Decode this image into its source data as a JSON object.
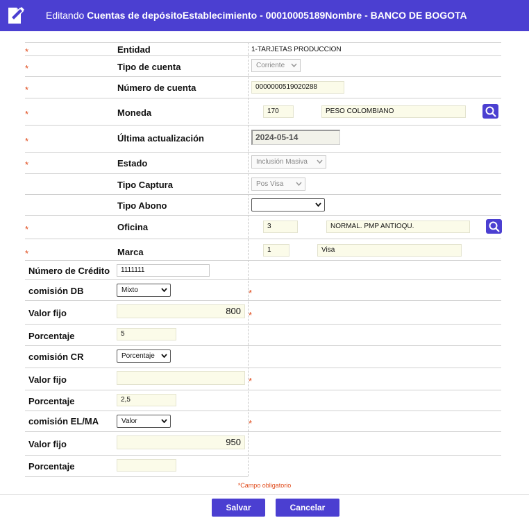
{
  "header": {
    "prefix": "Editando",
    "title": "Cuentas de depósitoEstablecimiento - 00010005189Nombre - BANCO DE BOGOTA"
  },
  "required_mark": "*",
  "form": {
    "entidad": {
      "label": "Entidad",
      "value": "1-TARJETAS PRODUCCION"
    },
    "tipo_cuenta": {
      "label": "Tipo de cuenta",
      "value": "Corriente"
    },
    "numero_cuenta": {
      "label": "Número de cuenta",
      "value": "0000000519020288"
    },
    "moneda": {
      "label": "Moneda",
      "code": "170",
      "name": "PESO COLOMBIANO"
    },
    "ultima_actualizacion": {
      "label": "Última actualización",
      "value": "2024-05-14"
    },
    "estado": {
      "label": "Estado",
      "value": "Inclusión Masiva"
    },
    "tipo_captura": {
      "label": "Tipo Captura",
      "value": "Pos Visa"
    },
    "tipo_abono": {
      "label": "Tipo Abono",
      "value": ""
    },
    "oficina": {
      "label": "Oficina",
      "code": "3",
      "name": "NORMAL. PMP ANTIOQU."
    },
    "marca": {
      "label": "Marca",
      "code": "1",
      "name": "Visa"
    },
    "numero_credito": {
      "label": "Número de Crédito",
      "value": "1111111"
    },
    "comision_db": {
      "label": "comisión DB",
      "value": "Mixto"
    },
    "valor_fijo_db": {
      "label": "Valor fijo",
      "value": "800"
    },
    "porcentaje_db": {
      "label": "Porcentaje",
      "value": "5"
    },
    "comision_cr": {
      "label": "comisión CR",
      "value": "Porcentaje"
    },
    "valor_fijo_cr": {
      "label": "Valor fijo",
      "value": ""
    },
    "porcentaje_cr": {
      "label": "Porcentaje",
      "value": "2,5"
    },
    "comision_elma": {
      "label": "comisión EL/MA",
      "value": "Valor"
    },
    "valor_fijo_elma": {
      "label": "Valor fijo",
      "value": "950"
    },
    "porcentaje_elma": {
      "label": "Porcentaje",
      "value": ""
    }
  },
  "footer": {
    "required_note": "Campo obligatorio",
    "save_label": "Salvar",
    "cancel_label": "Cancelar"
  },
  "icons": {
    "header": "edit-document-icon",
    "lookup": "search-icon",
    "dropdown": "chevron-down-icon"
  },
  "colors": {
    "accent": "#4b3fd1",
    "required": "#e04a1a",
    "input_bg": "#fbfbe9"
  }
}
